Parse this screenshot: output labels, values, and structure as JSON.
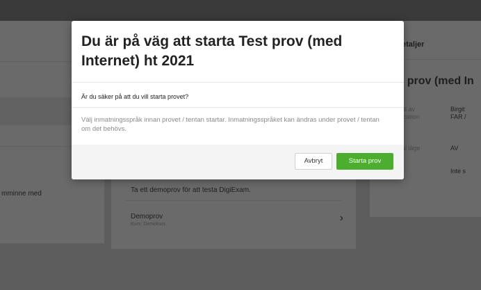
{
  "background": {
    "left_panel": {
      "partial_text": "mminne med"
    },
    "demo_card": {
      "description": "Ta ett demoprov för att testa DigiExam.",
      "demo_title": "Demoprov",
      "demo_subtitle": "Kurs: Demokurs"
    },
    "details_panel": {
      "header": "etaljer",
      "title": ": prov (med In",
      "row1_label": "al av",
      "row1_label2": "ication",
      "row1_value": "Birgit",
      "row1_value2": "FAR /",
      "row2_label": "al läge",
      "row2_value": "AV",
      "row3_value": "Inte s"
    }
  },
  "modal": {
    "title": "Du är på väg att starta Test prov (med Internet) ht 2021",
    "question": "Är du säker på att du vill starta provet?",
    "info": "Välj inmatningsspråk innan provet / tentan startar. Inmatningsspråket kan ändras under provet / tentan om det behövs.",
    "cancel_label": "Avbryt",
    "start_label": "Starta prov"
  },
  "colors": {
    "accent": "#4cae2f",
    "overlay": "#5d5d5d"
  }
}
